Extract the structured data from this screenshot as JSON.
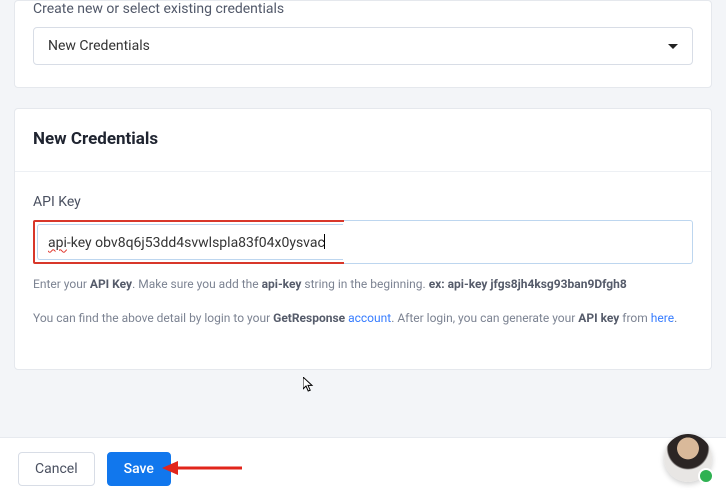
{
  "topSection": {
    "label": "Create new or select existing credentials",
    "selectedOption": "New Credentials"
  },
  "credCard": {
    "heading": "New Credentials",
    "apiKey": {
      "label": "API Key",
      "value_prefix_spell": "api",
      "value_rest": "-key obv8q6j53dd4svwlspla83f04x0ysvac",
      "hint": {
        "part1": "Enter your ",
        "bold1": "API Key",
        "part2": ". Make sure you add the ",
        "bold2": "api-key",
        "part3": " string in the beginning. ",
        "bold3": "ex: api-key jfgs8jh4ksg93ban9Dfgh8"
      },
      "findDetail": {
        "part1": "You can find the above detail by login to your ",
        "bold1": "GetResponse",
        "link1": "account",
        "part2": ". After login, you can generate your ",
        "bold2": "API key",
        "part3": " from ",
        "link2": "here",
        "part4": "."
      }
    }
  },
  "footer": {
    "cancel": "Cancel",
    "save": "Save"
  }
}
